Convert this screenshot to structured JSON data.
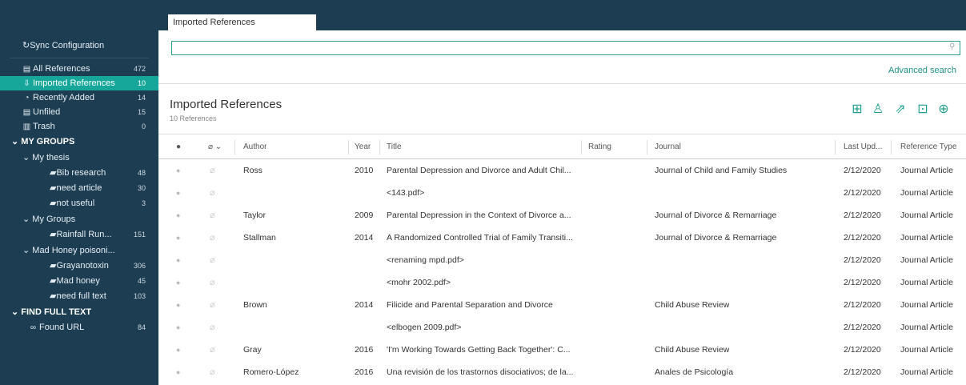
{
  "sidebar": {
    "sync": "Sync Configuration",
    "items": [
      {
        "label": "All References",
        "count": "472",
        "icon": "file-icon"
      },
      {
        "label": "Imported References",
        "count": "10",
        "icon": "import-icon"
      },
      {
        "label": "Recently Added",
        "count": "14",
        "icon": "clock-icon"
      },
      {
        "label": "Unfiled",
        "count": "15",
        "icon": "file-icon"
      },
      {
        "label": "Trash",
        "count": "0",
        "icon": "trash-icon"
      }
    ],
    "my_groups_header": "MY GROUPS",
    "groups": [
      {
        "label": "My thesis",
        "subs": [
          {
            "label": "Bib research",
            "count": "48"
          },
          {
            "label": "need article",
            "count": "30"
          },
          {
            "label": "not useful",
            "count": "3"
          }
        ]
      },
      {
        "label": "My Groups",
        "subs": [
          {
            "label": "Rainfall Run...",
            "count": "151"
          }
        ]
      },
      {
        "label": "Mad Honey poisoni...",
        "subs": [
          {
            "label": "Grayanotoxin",
            "count": "306"
          },
          {
            "label": "Mad honey",
            "count": "45"
          },
          {
            "label": "need full text",
            "count": "103"
          }
        ]
      }
    ],
    "find_full_text_header": "FIND FULL TEXT",
    "found_url": {
      "label": "Found URL",
      "count": "84"
    }
  },
  "tab": {
    "label": "Imported References"
  },
  "search": {
    "value": "",
    "advanced_label": "Advanced search"
  },
  "library": {
    "title": "Imported References",
    "subtitle": "10 References"
  },
  "table": {
    "headers": {
      "author": "Author",
      "year": "Year",
      "title": "Title",
      "rating": "Rating",
      "journal": "Journal",
      "updated": "Last Upd...",
      "type": "Reference Type"
    },
    "rows": [
      {
        "author": "Ross",
        "year": "2010",
        "title": "Parental Depression and Divorce and Adult Chil...",
        "journal": "Journal of Child and Family Studies",
        "updated": "2/12/2020",
        "type": "Journal Article"
      },
      {
        "author": "",
        "year": "",
        "title": "<143.pdf>",
        "journal": "",
        "updated": "2/12/2020",
        "type": "Journal Article"
      },
      {
        "author": "Taylor",
        "year": "2009",
        "title": "Parental Depression in the Context of Divorce a...",
        "journal": "Journal of Divorce & Remarriage",
        "updated": "2/12/2020",
        "type": "Journal Article"
      },
      {
        "author": "Stallman",
        "year": "2014",
        "title": "A Randomized Controlled Trial of Family Transiti...",
        "journal": "Journal of Divorce & Remarriage",
        "updated": "2/12/2020",
        "type": "Journal Article"
      },
      {
        "author": "",
        "year": "",
        "title": "<renaming mpd.pdf>",
        "journal": "",
        "updated": "2/12/2020",
        "type": "Journal Article"
      },
      {
        "author": "",
        "year": "",
        "title": "<mohr 2002.pdf>",
        "journal": "",
        "updated": "2/12/2020",
        "type": "Journal Article"
      },
      {
        "author": "Brown",
        "year": "2014",
        "title": "Filicide and Parental Separation and Divorce",
        "journal": "Child Abuse Review",
        "updated": "2/12/2020",
        "type": "Journal Article"
      },
      {
        "author": "",
        "year": "",
        "title": "<elbogen 2009.pdf>",
        "journal": "",
        "updated": "2/12/2020",
        "type": "Journal Article"
      },
      {
        "author": "Gray",
        "year": "2016",
        "title": "'I'm Working Towards Getting Back Together': C...",
        "journal": "Child Abuse Review",
        "updated": "2/12/2020",
        "type": "Journal Article"
      },
      {
        "author": "Romero-López",
        "year": "2016",
        "title": "Una revisión de los trastornos disociativos; de la...",
        "journal": "Anales de Psicología",
        "updated": "2/12/2020",
        "type": "Journal Article"
      }
    ]
  },
  "toolbar_icons": [
    "add-reference-icon",
    "share-user-icon",
    "export-icon",
    "find-pdf-icon",
    "web-icon"
  ],
  "colors": {
    "sidebar_bg": "#1c3d52",
    "accent": "#17a79a"
  }
}
